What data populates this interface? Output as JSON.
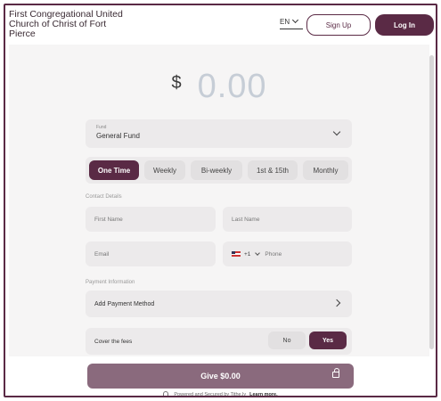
{
  "header": {
    "org_name": "First Congregational United Church of Christ of Fort Pierce",
    "language": "EN",
    "signup_label": "Sign Up",
    "login_label": "Log In"
  },
  "amount": {
    "currency_symbol": "$",
    "value": "0.00"
  },
  "fund": {
    "label": "Fund",
    "value": "General Fund"
  },
  "frequency": {
    "options": [
      "One Time",
      "Weekly",
      "Bi-weekly",
      "1st & 15th",
      "Monthly"
    ],
    "selected": "One Time"
  },
  "contact": {
    "section_label": "Contact Details",
    "first_name_placeholder": "First Name",
    "last_name_placeholder": "Last Name",
    "email_placeholder": "Email",
    "country_code": "+1",
    "phone_placeholder": "Phone"
  },
  "payment": {
    "section_label": "Payment Information",
    "add_method_label": "Add Payment Method"
  },
  "fees": {
    "label": "Cover the fees",
    "no_label": "No",
    "yes_label": "Yes",
    "selected": "Yes"
  },
  "footer": {
    "give_label": "Give $0.00",
    "powered_text": "Powered and Secured by Tithe.ly",
    "learn_more": "Learn more."
  },
  "colors": {
    "accent": "#5a2a45",
    "give_button": "#8a6a7d",
    "amount_text": "#c6cdd6"
  }
}
